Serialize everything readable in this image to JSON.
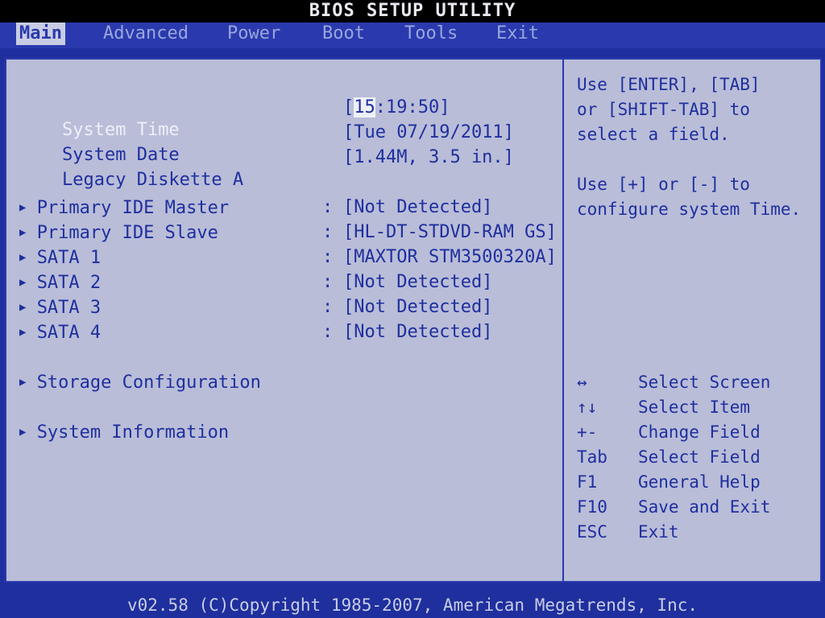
{
  "window_title": "BIOS SETUP UTILITY",
  "menu": [
    {
      "label": "Main",
      "active": true
    },
    {
      "label": "Advanced",
      "active": false
    },
    {
      "label": "Power",
      "active": false
    },
    {
      "label": "Boot",
      "active": false
    },
    {
      "label": "Tools",
      "active": false
    },
    {
      "label": "Exit",
      "active": false
    }
  ],
  "main": {
    "system_time": {
      "label": "System Time",
      "value_prefix": "[",
      "cursor_part": "15",
      "value_suffix": ":19:50]"
    },
    "system_date": {
      "label": "System Date",
      "value": "[Tue 07/19/2011]"
    },
    "legacy_diskette": {
      "label": "Legacy Diskette A",
      "value": "[1.44M, 3.5 in.]"
    },
    "devices": [
      {
        "label": "Primary IDE Master",
        "value": "[Not Detected]"
      },
      {
        "label": "Primary IDE Slave",
        "value": "[HL-DT-STDVD-RAM GS]"
      },
      {
        "label": "SATA 1",
        "value": "[MAXTOR STM3500320A]"
      },
      {
        "label": "SATA 2",
        "value": "[Not Detected]"
      },
      {
        "label": "SATA 3",
        "value": "[Not Detected]"
      },
      {
        "label": "SATA 4",
        "value": "[Not Detected]"
      }
    ],
    "storage_configuration": "Storage Configuration",
    "system_information": "System Information"
  },
  "help": {
    "lines": [
      "Use [ENTER], [TAB]",
      "or [SHIFT-TAB] to",
      "select a field.",
      "",
      "Use [+] or [-] to",
      "configure system Time."
    ],
    "keys": [
      {
        "key": "↔",
        "action": "Select Screen"
      },
      {
        "key": "↑↓",
        "action": "Select Item"
      },
      {
        "key": "+-",
        "action": "Change Field"
      },
      {
        "key": "Tab",
        "action": "Select Field"
      },
      {
        "key": "F1",
        "action": "General Help"
      },
      {
        "key": "F10",
        "action": "Save and Exit"
      },
      {
        "key": "ESC",
        "action": "Exit"
      }
    ]
  },
  "footer": "v02.58 (C)Copyright 1985-2007, American Megatrends, Inc.",
  "colors": {
    "background": "#1f2f9e",
    "panel": "#b9bdd8",
    "selected_text": "#eef0f8"
  }
}
